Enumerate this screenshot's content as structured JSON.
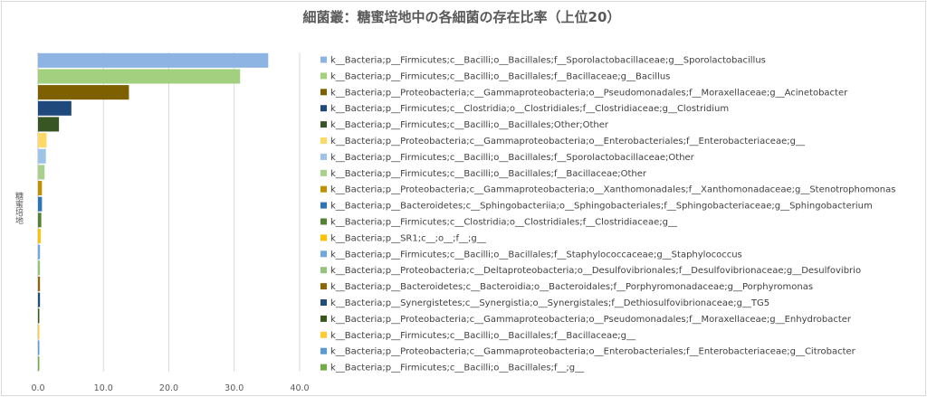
{
  "chart_data": {
    "type": "bar",
    "orientation": "horizontal",
    "title": "細菌叢：糖蜜培地中の各細菌の存在比率（上位20）",
    "ylabel": "糖蜜培地",
    "xlim": [
      0,
      40
    ],
    "xticks": [
      "0.0",
      "10.0",
      "20.0",
      "30.0",
      "40.0"
    ],
    "grid": true,
    "legend_position": "right",
    "series": [
      {
        "name": "k__Bacteria;p__Firmicutes;c__Bacilli;o__Bacillales;f__Sporolactobacillaceae;g__Sporolactobacillus",
        "value": 35.2,
        "color": "#8db4e2"
      },
      {
        "name": "k__Bacteria;p__Firmicutes;c__Bacilli;o__Bacillales;f__Bacillaceae;g__Bacillus",
        "value": 30.9,
        "color": "#a2d07f"
      },
      {
        "name": "k__Bacteria;p__Proteobacteria;c__Gammaproteobacteria;o__Pseudomonadales;f__Moraxellaceae;g__Acinetobacter",
        "value": 13.9,
        "color": "#7f6000"
      },
      {
        "name": "k__Bacteria;p__Firmicutes;c__Clostridia;o__Clostridiales;f__Clostridiaceae;g__Clostridium",
        "value": 5.1,
        "color": "#1f497d"
      },
      {
        "name": "k__Bacteria;p__Firmicutes;c__Bacilli;o__Bacillales;Other;Other",
        "value": 3.2,
        "color": "#375623"
      },
      {
        "name": "k__Bacteria;p__Proteobacteria;c__Gammaproteobacteria;o__Enterobacteriales;f__Enterobacteriaceae;g__",
        "value": 1.3,
        "color": "#ffd966"
      },
      {
        "name": "k__Bacteria;p__Firmicutes;c__Bacilli;o__Bacillales;f__Sporolactobacillaceae;Other",
        "value": 1.2,
        "color": "#9dc3e6"
      },
      {
        "name": "k__Bacteria;p__Firmicutes;c__Bacilli;o__Bacillales;f__Bacillaceae;Other",
        "value": 1.0,
        "color": "#a9d18e"
      },
      {
        "name": "k__Bacteria;p__Proteobacteria;c__Gammaproteobacteria;o__Xanthomonadales;f__Xanthomonadaceae;g__Stenotrophomonas",
        "value": 0.6,
        "color": "#bf9000"
      },
      {
        "name": "k__Bacteria;p__Bacteroidetes;c__Sphingobacteriia;o__Sphingobacteriales;f__Sphingobacteriaceae;g__Sphingobacterium",
        "value": 0.6,
        "color": "#2e75b6"
      },
      {
        "name": "k__Bacteria;p__Firmicutes;c__Clostridia;o__Clostridiales;f__Clostridiaceae;g__",
        "value": 0.5,
        "color": "#548235"
      },
      {
        "name": "k__Bacteria;p__SR1;c__;o__;f__;g__",
        "value": 0.4,
        "color": "#ffc000"
      },
      {
        "name": "k__Bacteria;p__Firmicutes;c__Bacilli;o__Bacillales;f__Staphylococcaceae;g__Staphylococcus",
        "value": 0.3,
        "color": "#6fa8dc"
      },
      {
        "name": "k__Bacteria;p__Proteobacteria;c__Deltaproteobacteria;o__Desulfovibrionales;f__Desulfovibrionaceae;g__Desulfovibrio",
        "value": 0.3,
        "color": "#93c47d"
      },
      {
        "name": "k__Bacteria;p__Bacteroidetes;c__Bacteroidia;o__Bacteroidales;f__Porphyromonadaceae;g__Porphyromonas",
        "value": 0.3,
        "color": "#8b6508"
      },
      {
        "name": "k__Bacteria;p__Synergistetes;c__Synergistia;o__Synergistales;f__Dethiosulfovibrionaceae;g__TG5",
        "value": 0.3,
        "color": "#1f4e79"
      },
      {
        "name": "k__Bacteria;p__Proteobacteria;c__Gammaproteobacteria;o__Pseudomonadales;f__Moraxellaceae;g__Enhydrobacter",
        "value": 0.2,
        "color": "#38571a"
      },
      {
        "name": "k__Bacteria;p__Firmicutes;c__Bacilli;o__Bacillales;f__Bacillaceae;g__",
        "value": 0.2,
        "color": "#ffcc33"
      },
      {
        "name": "k__Bacteria;p__Proteobacteria;c__Gammaproteobacteria;o__Enterobacteriales;f__Enterobacteriaceae;g__Citrobacter",
        "value": 0.2,
        "color": "#5b9bd5"
      },
      {
        "name": "k__Bacteria;p__Firmicutes;c__Bacilli;o__Bacillales;f__;g__",
        "value": 0.2,
        "color": "#70ad47"
      }
    ]
  }
}
